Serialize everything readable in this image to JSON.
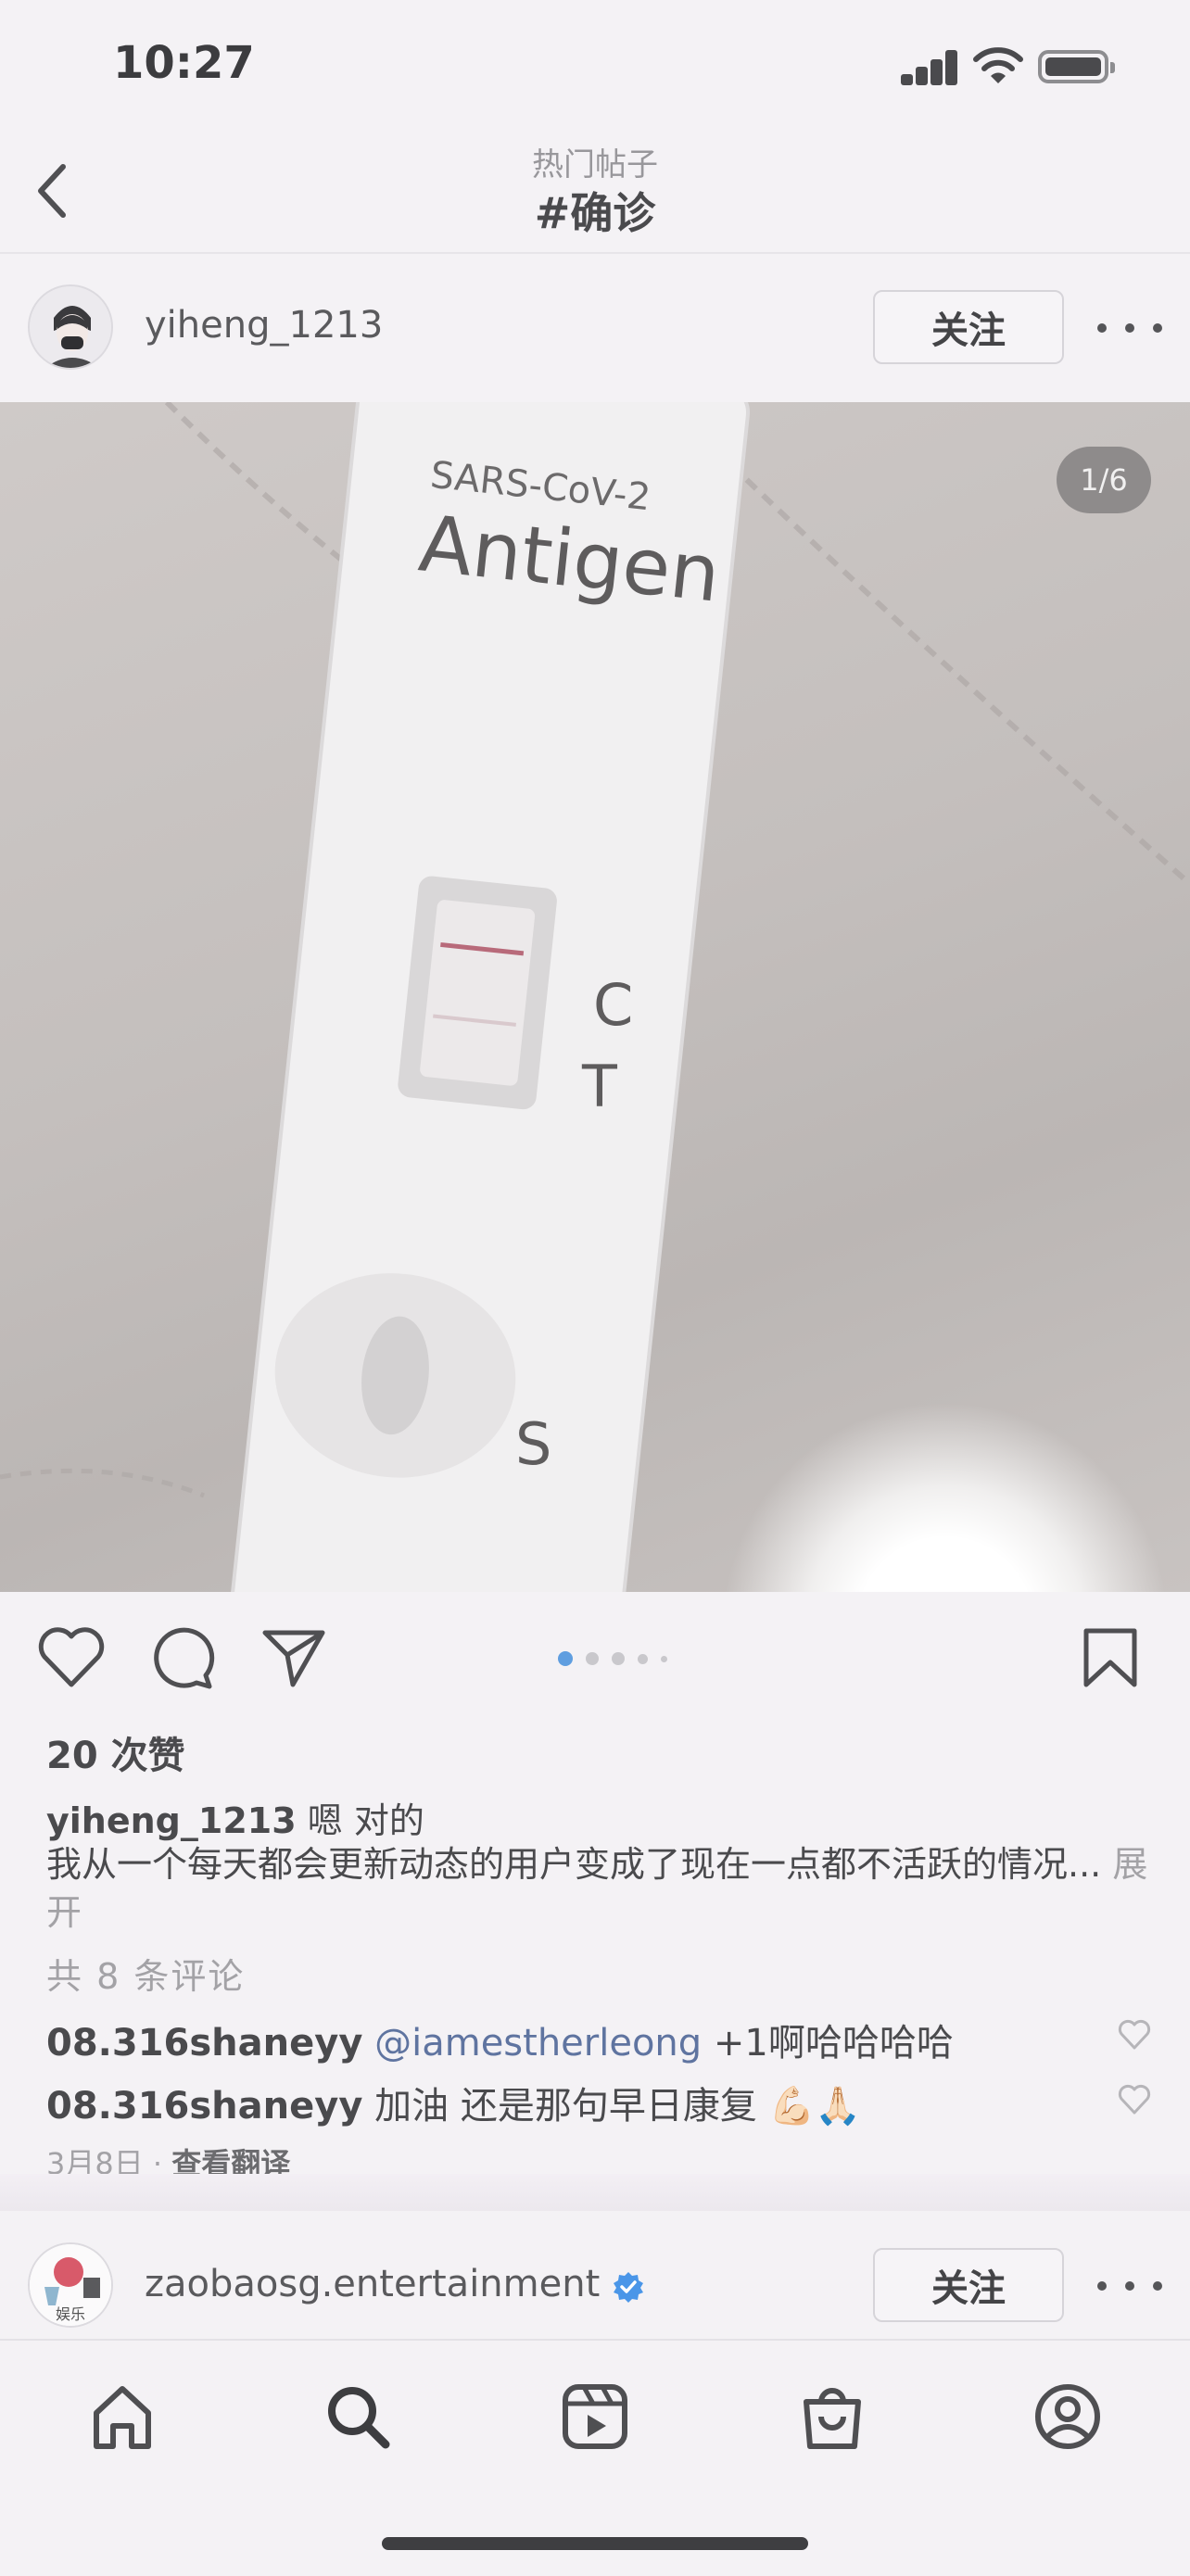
{
  "status_bar": {
    "time": "10:27"
  },
  "nav": {
    "subtitle": "热门帖子",
    "title": "#确诊"
  },
  "post": {
    "username": "yiheng_1213",
    "follow_label": "关注",
    "page_counter": "1/6",
    "photo_text": {
      "line1": "SARS-CoV-2",
      "line2": "Antigen",
      "c_mark": "C",
      "t_mark": "T",
      "s_mark": "S"
    },
    "carousel": {
      "total": 5,
      "active": 1
    },
    "likes": "20 次赞",
    "caption_user": "yiheng_1213",
    "caption_first": "嗯 对的",
    "caption_body": "我从一个每天都会更新动态的用户变成了现在一点都不活跃的情况...",
    "caption_more": "展开",
    "comments_count": "共 8 条评论",
    "comments": [
      {
        "user": "08.316shaneyy",
        "mention": "@iamestherleong",
        "text": " +1啊哈哈哈哈"
      },
      {
        "user": "08.316shaneyy",
        "mention": "",
        "text": "加油 还是那句早日康复 💪🏻🙏🏻"
      }
    ],
    "date": "3月8日",
    "date_separator": "·",
    "translate_label": "查看翻译"
  },
  "next_post": {
    "username": "zaobaosg.entertainment",
    "follow_label": "关注",
    "avatar_text": "娱乐",
    "verified": true
  },
  "colors": {
    "accent_blue": "#5f9ee0",
    "verified_blue": "#4a96e8"
  },
  "tabs": [
    {
      "icon": "home-icon"
    },
    {
      "icon": "search-icon"
    },
    {
      "icon": "reels-icon"
    },
    {
      "icon": "shop-icon"
    },
    {
      "icon": "profile-icon"
    }
  ]
}
